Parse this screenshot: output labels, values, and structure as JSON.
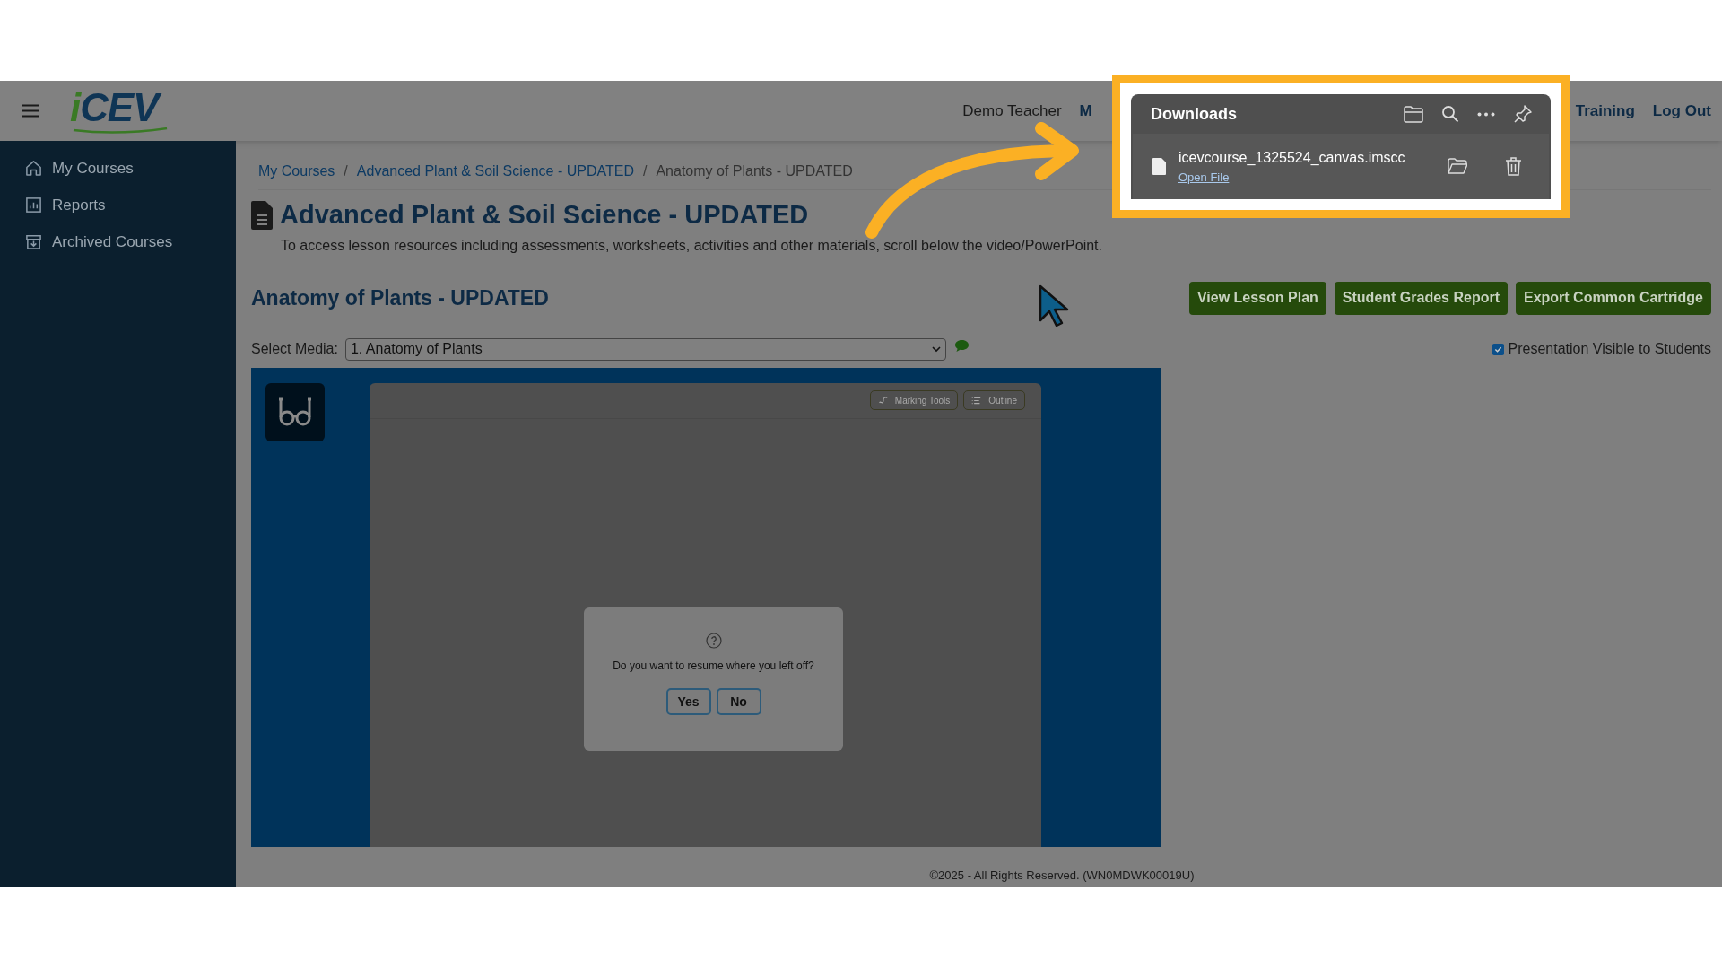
{
  "header": {
    "logo": "iCEV",
    "nav": [
      {
        "label": "Demo Teacher",
        "kind": "plain"
      },
      {
        "label": "M",
        "kind": "link"
      },
      {
        "label": "Training",
        "kind": "link"
      },
      {
        "label": "Log Out",
        "kind": "link"
      }
    ]
  },
  "sidebar": {
    "items": [
      {
        "label": "My Courses"
      },
      {
        "label": "Reports"
      },
      {
        "label": "Archived Courses"
      }
    ]
  },
  "breadcrumb": [
    {
      "label": "My Courses",
      "current": false
    },
    {
      "separator": "/",
      "label": "Advanced Plant & Soil Science - UPDATED",
      "current": false
    },
    {
      "separator": "/",
      "label": "Anatomy of Plants - UPDATED",
      "current": true
    }
  ],
  "course_title": "Advanced Plant & Soil Science - UPDATED",
  "description": "To access lesson resources including assessments, worksheets, activities and other materials, scroll below the video/PowerPoint.",
  "lesson_title": "Anatomy of Plants - UPDATED",
  "actions": [
    "View Lesson Plan",
    "Student Grades Report",
    "Export Common Cartridge"
  ],
  "select_media": {
    "label": "Select Media:",
    "value": "1. Anatomy of Plants"
  },
  "visibility": {
    "label": "Presentation Visible to Students",
    "checked": true
  },
  "player": {
    "tools": [
      "Marking Tools",
      "Outline"
    ],
    "dialog": {
      "message": "Do you want to resume where you left off?",
      "buttons": [
        "Yes",
        "No"
      ]
    }
  },
  "footer": {
    "text": "©2025 - All Rights Reserved. (WN0MDWK00019U)"
  },
  "downloads": {
    "title": "Downloads",
    "file": {
      "name": "icevcourse_1325524_canvas.imscc",
      "action": "Open File"
    }
  }
}
